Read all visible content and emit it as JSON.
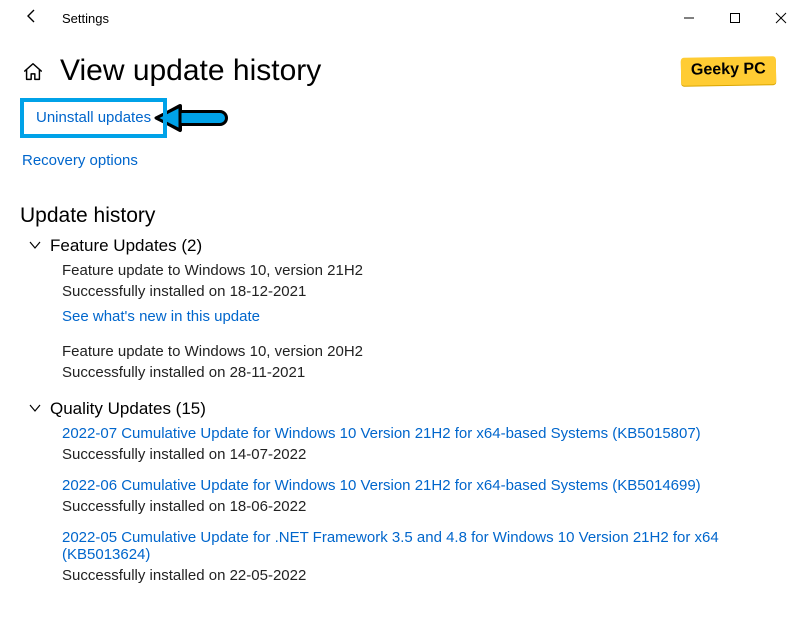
{
  "titlebar": {
    "text": "Settings"
  },
  "header": {
    "heading": "View update history"
  },
  "branding": {
    "label": "Geeky PC"
  },
  "links": {
    "uninstall": "Uninstall updates",
    "recovery": "Recovery options",
    "whats_new": "See what's new in this update"
  },
  "sections": {
    "update_history": "Update history"
  },
  "groups": {
    "feature": {
      "title": "Feature Updates (2)"
    },
    "quality": {
      "title": "Quality Updates (15)"
    }
  },
  "feature_items": [
    {
      "title": "Feature update to Windows 10, version 21H2",
      "status": "Successfully installed on 18-12-2021",
      "has_whatsnew": true
    },
    {
      "title": "Feature update to Windows 10, version 20H2",
      "status": "Successfully installed on 28-11-2021",
      "has_whatsnew": false
    }
  ],
  "quality_items": [
    {
      "title": "2022-07 Cumulative Update for Windows 10 Version 21H2 for x64-based Systems (KB5015807)",
      "status": "Successfully installed on 14-07-2022"
    },
    {
      "title": "2022-06 Cumulative Update for Windows 10 Version 21H2 for x64-based Systems (KB5014699)",
      "status": "Successfully installed on 18-06-2022"
    },
    {
      "title": "2022-05 Cumulative Update for .NET Framework 3.5 and 4.8 for Windows 10 Version 21H2 for x64 (KB5013624)",
      "status": "Successfully installed on 22-05-2022"
    }
  ]
}
